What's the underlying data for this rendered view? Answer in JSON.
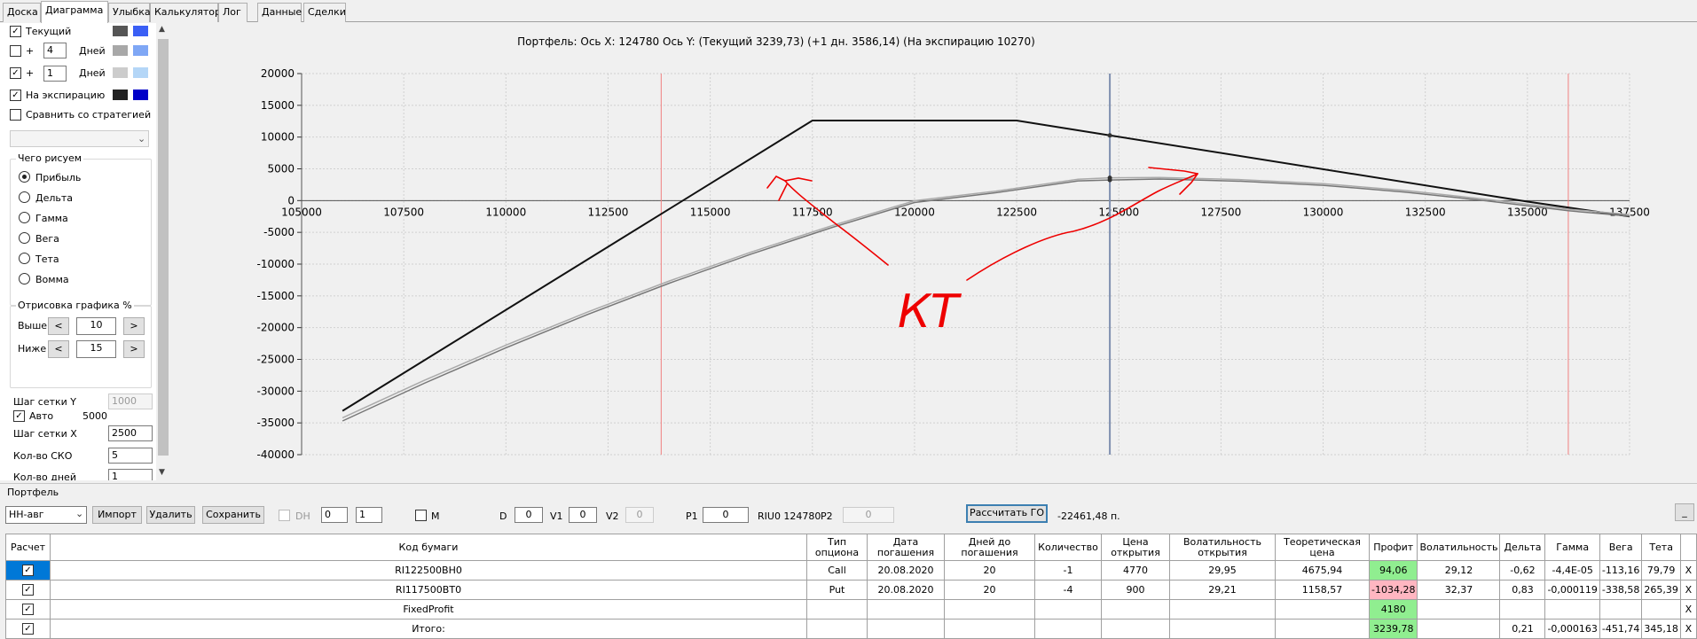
{
  "tabs": [
    "Доска",
    "Диаграмма",
    "Улыбка",
    "Калькулятор",
    "Лог",
    "Данные",
    "Сделки"
  ],
  "left_panel": {
    "current_label": "Текущий",
    "plus1": "+",
    "days_value_1": "4",
    "days_label": "Дней",
    "plus2": "+",
    "days_value_2": "1",
    "expiration_label": "На экспирацию",
    "compare_label": "Сравнить со стратегией",
    "what_draw_title": "Чего рисуем",
    "radio_options": [
      "Прибыль",
      "Дельта",
      "Гамма",
      "Вега",
      "Тета",
      "Вомма"
    ],
    "draw_title": "Отрисовка графика %",
    "above_label": "Выше",
    "above_value": "10",
    "below_label": "Ниже",
    "below_value": "15",
    "btn_left": "<",
    "btn_right": ">",
    "grid_y_label": "Шаг сетки Y",
    "grid_y_value": "1000",
    "auto_label": "Авто",
    "auto_value": "5000",
    "grid_x_label": "Шаг сетки X",
    "grid_x_value": "2500",
    "sko_label": "Кол-во СКО",
    "sko_value": "5",
    "days_count_label": "Кол-во дней",
    "days_count_value": "1"
  },
  "colors": {
    "current": [
      "#555555",
      "#3a5ff5"
    ],
    "plus_days_1": [
      "#a8a8a8",
      "#7fa7f5"
    ],
    "plus_days_2": [
      "#cccccc",
      "#b4d6f7"
    ],
    "expiration": [
      "#222222",
      "#0000c8"
    ]
  },
  "chart_data": {
    "type": "line",
    "title": "Портфель: Ось X: 124780 Ось Y:  (Текущий 3239,73)  (+1 дн. 3586,14)  (На экспирацию 10270)",
    "xlim": [
      105000,
      137500
    ],
    "ylim": [
      -40000,
      20000
    ],
    "x_ticks": [
      105000,
      107500,
      110000,
      112500,
      115000,
      117500,
      120000,
      122500,
      125000,
      127500,
      130000,
      132500,
      135000,
      137500
    ],
    "y_ticks": [
      20000,
      15000,
      10000,
      5000,
      0,
      -5000,
      -10000,
      -15000,
      -20000,
      -25000,
      -30000,
      -35000,
      -40000
    ],
    "x_tick_labels": [
      "105000",
      "107500",
      "110000",
      "112500",
      "115000",
      "117500",
      "120000",
      "122500",
      "125000",
      "127500",
      "130000",
      "132500",
      "135000",
      "137500"
    ],
    "y_tick_labels": [
      "20000",
      "15000",
      "10000",
      "5000",
      "0",
      "-5000",
      "-10000",
      "-15000",
      "-20000",
      "-25000",
      "-30000",
      "-35000",
      "-40000"
    ],
    "current_x": 124780,
    "sigma_lines": [
      113800,
      136000
    ],
    "series": [
      {
        "color": "#111111",
        "x": [
          106000,
          117500,
          118000,
          122500,
          124780,
          134950,
          137500
        ],
        "y": [
          -33100,
          12600,
          12600,
          12600,
          10270,
          -100,
          -2500
        ]
      },
      {
        "color": "#777777",
        "x": [
          106000,
          108000,
          110000,
          112000,
          114000,
          116000,
          118000,
          120000,
          122000,
          124000,
          124780,
          126000,
          128000,
          130000,
          132000,
          134000,
          136000,
          137500
        ],
        "y": [
          -34700,
          -28770,
          -23170,
          -17920,
          -13000,
          -8420,
          -4190,
          -300,
          1240,
          3100,
          3240,
          3400,
          3050,
          2400,
          1350,
          -40,
          -1600,
          -2450
        ]
      },
      {
        "color": "#aaaaaa",
        "x": [
          106000,
          108000,
          110000,
          112000,
          114000,
          116000,
          118000,
          120000,
          122000,
          124000,
          124780,
          126000,
          128000,
          130000,
          132000,
          134000,
          136000,
          137500
        ],
        "y": [
          -34200,
          -28300,
          -22750,
          -17550,
          -12650,
          -8100,
          -3900,
          -30,
          1500,
          3350,
          3586,
          3650,
          3300,
          2650,
          1600,
          200,
          -1350,
          -2200
        ]
      }
    ],
    "annotation_text": "КТ"
  },
  "portfolio": {
    "section_label": "Портфель",
    "select_value": "НН-авг",
    "import_label": "Импорт",
    "delete_label": "Удалить",
    "save_label": "Сохранить",
    "dh_label": "DH",
    "dh_v1": "0",
    "dh_v2": "1",
    "m_label": "M",
    "d_label": "D",
    "d_value": "0",
    "v1_label": "V1",
    "v1_value": "0",
    "v2_label": "V2",
    "v2_value": "0",
    "p1_label": "P1",
    "p1_value": "0",
    "riu_label": "RIU0 124780",
    "p2_label": "P2",
    "p2_value": "0",
    "calc_go_label": "Рассчитать ГО",
    "go_value": "-22461,48 п.",
    "min_label": "_"
  },
  "table": {
    "headers": [
      "Расчет",
      "Код бумаги",
      "Тип опциона",
      "Дата погашения",
      "Дней до погашения",
      "Количество",
      "Цена открытия",
      "Волатильность открытия",
      "Теоретическая цена",
      "Профит",
      "Волатильность",
      "Дельта",
      "Гамма",
      "Вега",
      "Тета",
      ""
    ],
    "rows": [
      {
        "checked": "✓",
        "code": "RI122500BH0",
        "type": "Call",
        "date": "20.08.2020",
        "days": "20",
        "qty": "-1",
        "price": "4770",
        "vol_open": "29,95",
        "theo": "4675,94",
        "profit": "94,06",
        "profit_color": "green",
        "vol": "29,12",
        "delta": "-0,62",
        "gamma": "-4,4E-05",
        "vega": "-113,16",
        "theta": "79,79",
        "x": "X"
      },
      {
        "checked": "✓",
        "code": "RI117500BT0",
        "type": "Put",
        "date": "20.08.2020",
        "days": "20",
        "qty": "-4",
        "price": "900",
        "vol_open": "29,21",
        "theo": "1158,57",
        "profit": "-1034,28",
        "profit_color": "pink",
        "vol": "32,37",
        "delta": "0,83",
        "gamma": "-0,000119",
        "vega": "-338,58",
        "theta": "265,39",
        "x": "X"
      },
      {
        "checked": "✓",
        "code": "FixedProfit",
        "type": "",
        "date": "",
        "days": "",
        "qty": "",
        "price": "",
        "vol_open": "",
        "theo": "",
        "profit": "4180",
        "profit_color": "green",
        "vol": "",
        "delta": "",
        "gamma": "",
        "vega": "",
        "theta": "",
        "x": "X"
      },
      {
        "checked": "✓",
        "code": "Итого:",
        "type": "",
        "date": "",
        "days": "",
        "qty": "",
        "price": "",
        "vol_open": "",
        "theo": "",
        "profit": "3239,78",
        "profit_color": "green",
        "vol": "",
        "delta": "0,21",
        "gamma": "-0,000163",
        "vega": "-451,74",
        "theta": "345,18",
        "x": "X"
      }
    ]
  }
}
